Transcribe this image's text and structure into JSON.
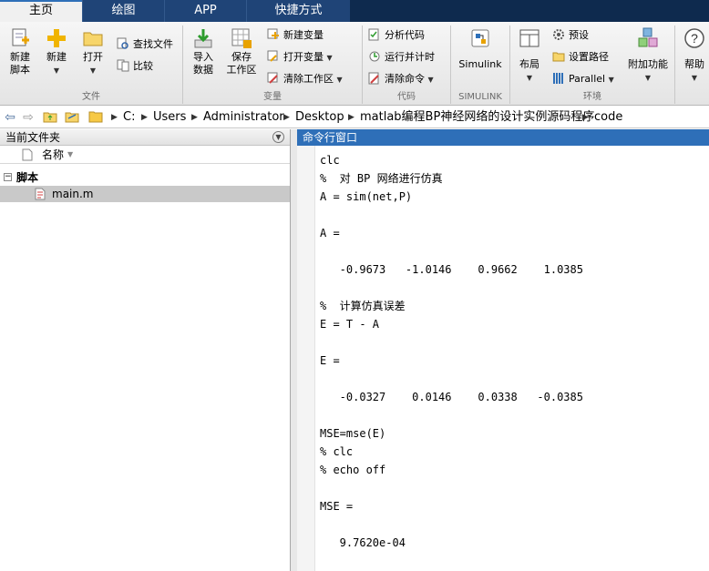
{
  "tabs": [
    {
      "label": "主页",
      "active": true
    },
    {
      "label": "绘图",
      "active": false
    },
    {
      "label": "APP",
      "active": false
    },
    {
      "label": "快捷方式",
      "active": false
    }
  ],
  "ribbon": {
    "file": {
      "new_script": "新建\n脚本",
      "new": "新建",
      "open": "打开",
      "find_files": "查找文件",
      "compare": "比较",
      "group": "文件"
    },
    "variable": {
      "import": "导入\n数据",
      "save_ws": "保存\n工作区",
      "new_var": "新建变量",
      "open_var": "打开变量",
      "clear_ws": "清除工作区",
      "group": "变量"
    },
    "code": {
      "analyze": "分析代码",
      "run_time": "运行并计时",
      "clear_cmd": "清除命令",
      "group": "代码"
    },
    "simulink": {
      "button": "Simulink",
      "group": "SIMULINK"
    },
    "env": {
      "layout": "布局",
      "prefs": "预设",
      "set_path": "设置路径",
      "parallel": "Parallel",
      "addons": "附加功能",
      "group": "环境"
    },
    "help": "帮助"
  },
  "address": {
    "parts": [
      "C:",
      "Users",
      "Administrator",
      "Desktop",
      "matlab编程BP神经网络的设计实例源码程序",
      "code"
    ]
  },
  "left_panel": {
    "title": "当前文件夹",
    "column": "名称",
    "section": "脚本",
    "file": "main.m"
  },
  "command_window": {
    "title": "命令行窗口",
    "lines": [
      "clc",
      "%  对 BP 网络进行仿真",
      "A = sim(net,P)",
      "",
      "A =",
      "",
      "   -0.9673   -1.0146    0.9662    1.0385",
      "",
      "%  计算仿真误差",
      "E = T - A",
      "",
      "E =",
      "",
      "   -0.0327    0.0146    0.0338   -0.0385",
      "",
      "MSE=mse(E)",
      "% clc",
      "% echo off",
      "",
      "MSE =",
      "",
      "   9.7620e-04",
      ""
    ]
  },
  "colors": {
    "tab_bar": "#0e2a4e",
    "cmd_header": "#2e6fb8",
    "selected_row": "#c9c9c9"
  }
}
